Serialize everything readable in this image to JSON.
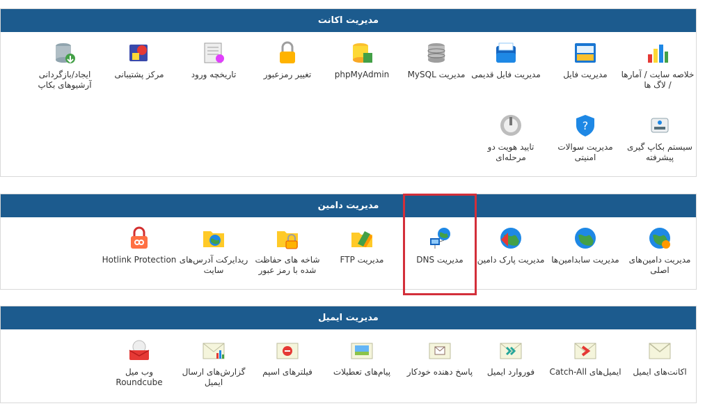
{
  "account": {
    "title": "مدیریت اکانت",
    "items": [
      {
        "label": "خلاصه سایت / آمارها / لاگ ها",
        "icon": "stats-chart-icon"
      },
      {
        "label": "مدیریت فایل",
        "icon": "file-manager-icon"
      },
      {
        "label": "مدیریت فایل قدیمی",
        "icon": "legacy-file-manager-icon"
      },
      {
        "label": "مدیریت MySQL",
        "icon": "database-icon"
      },
      {
        "label": "phpMyAdmin",
        "icon": "phpmyadmin-icon"
      },
      {
        "label": "تغییر رمزعبور",
        "icon": "padlock-icon"
      },
      {
        "label": "تاریخچه ورود",
        "icon": "login-history-icon"
      },
      {
        "label": "مرکز پشتیبانی",
        "icon": "support-center-icon"
      },
      {
        "label": "ایجاد/بازگردانی آرشیوهای بکاپ",
        "icon": "backup-archive-icon"
      },
      {
        "label": "سیستم بکاپ گیری پیشرفته",
        "icon": "backup-drive-icon"
      },
      {
        "label": "مدیریت سوالات امنیتی",
        "icon": "security-shield-icon"
      },
      {
        "label": "تایید هویت دو مرحله‌ای",
        "icon": "two-factor-icon"
      }
    ]
  },
  "domain": {
    "title": "مدیریت دامین",
    "items": [
      {
        "label": "مدیریت دامین‌های اصلی",
        "icon": "globe-gear-icon"
      },
      {
        "label": "مدیریت سابدامین‌ها",
        "icon": "globe-icon"
      },
      {
        "label": "مدیریت پارک دامین",
        "icon": "globe-park-icon"
      },
      {
        "label": "مدیریت DNS",
        "icon": "dns-network-icon"
      },
      {
        "label": "مدیریت FTP",
        "icon": "ftp-folder-icon"
      },
      {
        "label": "شاخه های حفاظت شده با رمز عبور",
        "icon": "protected-folder-icon"
      },
      {
        "label": "ریدایرکت آدرس‌های سایت",
        "icon": "redirect-folder-icon"
      },
      {
        "label": "Hotlink Protection",
        "icon": "hotlink-lock-icon"
      }
    ]
  },
  "email": {
    "title": "مدیریت ایمیل",
    "items": [
      {
        "label": "اکانت‌های ایمیل",
        "icon": "mail-envelope-icon"
      },
      {
        "label": "ایمیل‌های Catch-All",
        "icon": "catch-all-icon"
      },
      {
        "label": "فوروارد ایمیل",
        "icon": "mail-forward-icon"
      },
      {
        "label": "پاسخ دهنده خودکار",
        "icon": "autoresponder-icon"
      },
      {
        "label": "پیام‌های تعطیلات",
        "icon": "vacation-message-icon"
      },
      {
        "label": "فیلترهای اسپم",
        "icon": "spam-filter-icon"
      },
      {
        "label": "گزارش‌های ارسال ایمیل",
        "icon": "email-report-icon"
      },
      {
        "label": "وب میل Roundcube",
        "icon": "webmail-icon"
      }
    ]
  },
  "colors": {
    "header": "#1c5b8e",
    "highlight": "#d32f3a"
  }
}
